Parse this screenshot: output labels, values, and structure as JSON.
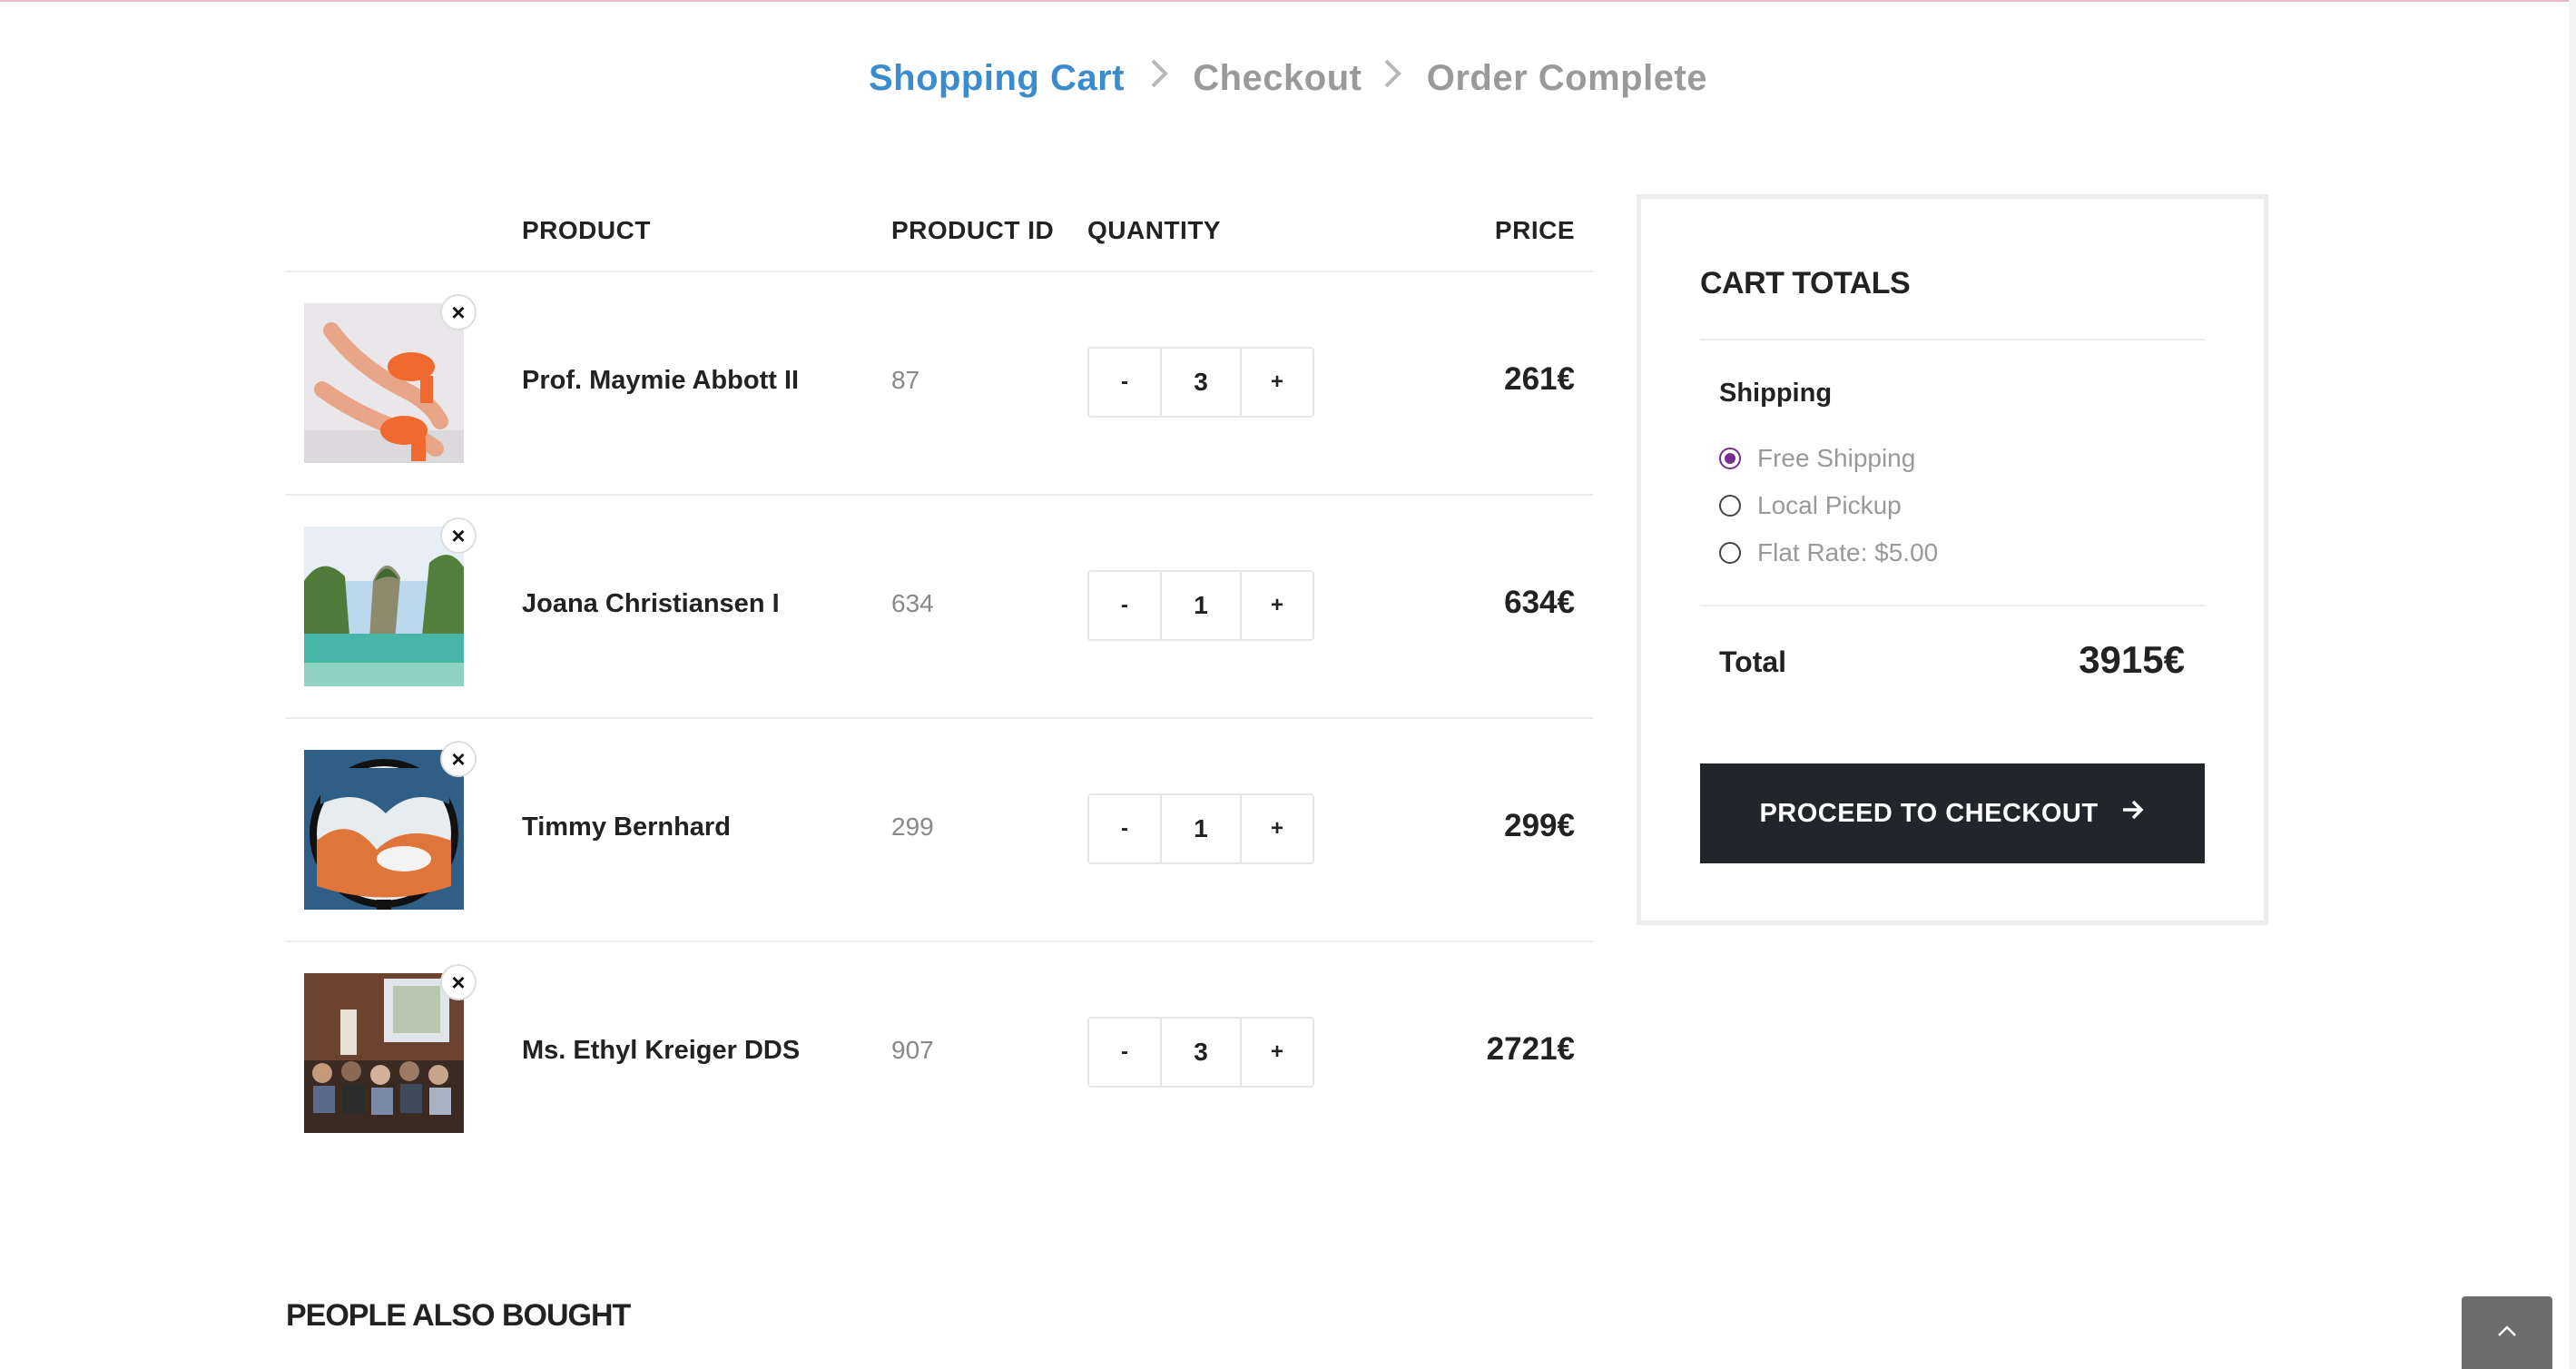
{
  "breadcrumb": {
    "steps": [
      "Shopping Cart",
      "Checkout",
      "Order Complete"
    ]
  },
  "table": {
    "headers": {
      "product": "PRODUCT",
      "product_id": "PRODUCT ID",
      "quantity": "QUANTITY",
      "price": "PRICE"
    },
    "rows": [
      {
        "name": "Prof. Maymie Abbott II",
        "id": "87",
        "qty": "3",
        "price": "261€",
        "image": "orange-sandals-photo"
      },
      {
        "name": "Joana Christiansen I",
        "id": "634",
        "qty": "1",
        "price": "634€",
        "image": "tropical-island-rock-photo"
      },
      {
        "name": "Timmy Bernhard",
        "id": "299",
        "qty": "1",
        "price": "299€",
        "image": "sand-art-frame-photo"
      },
      {
        "name": "Ms. Ethyl Kreiger DDS",
        "id": "907",
        "qty": "3",
        "price": "2721€",
        "image": "conference-audience-photo"
      }
    ],
    "remove_symbol": "×",
    "minus_label": "-",
    "plus_label": "+"
  },
  "totals": {
    "title": "CART TOTALS",
    "shipping_label": "Shipping",
    "options": [
      "Free Shipping",
      "Local Pickup",
      "Flat Rate: $5.00"
    ],
    "selected_option": "Free Shipping",
    "total_label": "Total",
    "total_value": "3915€",
    "checkout_label": "PROCEED TO CHECKOUT",
    "accent_color": "#7b2d8e",
    "button_color": "#222529"
  },
  "people_also_bought": "PEOPLE ALSO BOUGHT",
  "colors": {
    "active_step": "#3a8ccf",
    "inactive_step": "#9a9a9a"
  }
}
